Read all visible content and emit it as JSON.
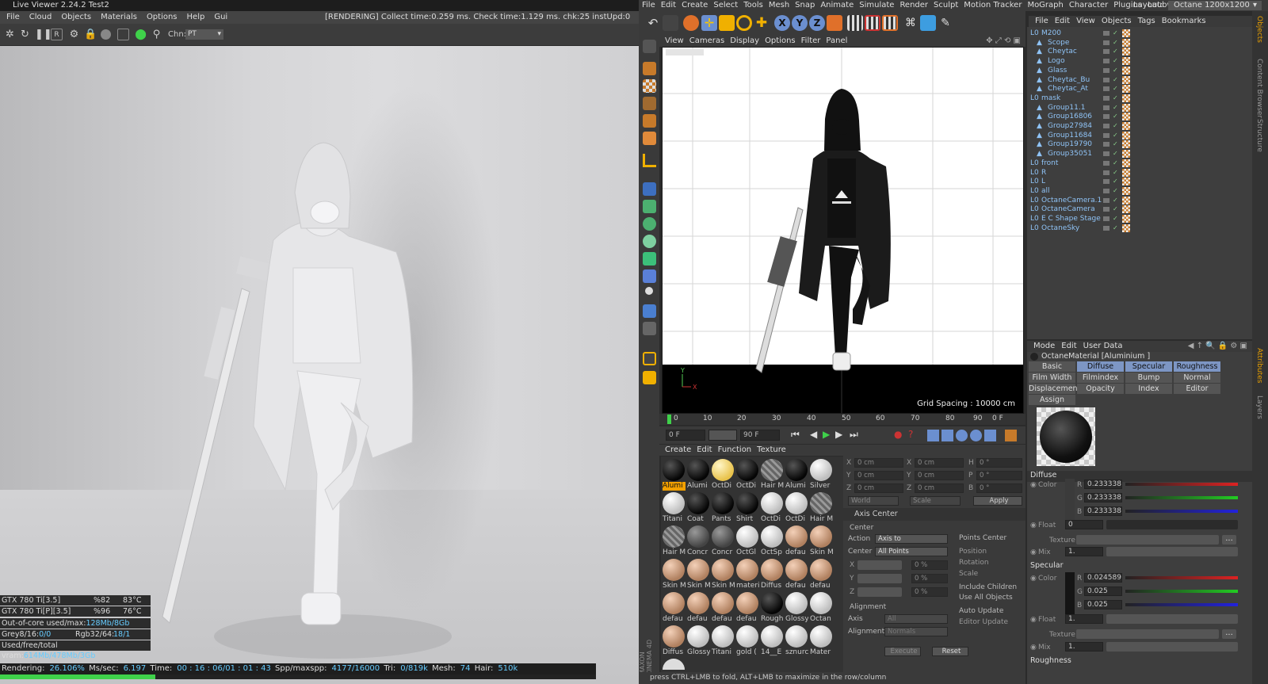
{
  "live_viewer": {
    "title": "Live Viewer 2.24.2 Test2",
    "menu": [
      "File",
      "Cloud",
      "Objects",
      "Materials",
      "Options",
      "Help",
      "Gui"
    ],
    "status": "[RENDERING] Collect time:0.259 ms.  Check time:1.129 ms.  chk:25  instUpd:0",
    "channel_label": "Chn:",
    "channel_value": "PT",
    "gpu_rows": [
      {
        "name": "GTX 780 Ti[3.5]",
        "usage": "%82",
        "temp": "83°C"
      },
      {
        "name": "GTX 780 Ti[P][3.5]",
        "usage": "%96",
        "temp": "76°C"
      }
    ],
    "out_of_core_label": "Out-of-core used/max:",
    "out_of_core_value": "128Mb/8Gb",
    "grey_label": "Grey8/16:",
    "grey_value": "0/0",
    "rgb_label": "Rgb32/64:",
    "rgb_value": "18/1",
    "vram_label": "Used/free/total vram:",
    "vram_value": "614Mb/478Mb/3Gb",
    "stats": {
      "rendering_label": "Rendering:",
      "rendering_value": "26.106%",
      "ms_label": "Ms/sec:",
      "ms_value": "6.197",
      "time_label": "Time:",
      "time_value": "00 : 16 : 06/01 : 01 : 43",
      "spp_label": "Spp/maxspp:",
      "spp_value": "4177/16000",
      "tri_label": "Tri:",
      "tri_value": "0/819k",
      "mesh_label": "Mesh:",
      "mesh_value": "74",
      "hair_label": "Hair:",
      "hair_value": "510k"
    },
    "progress": 0.26106
  },
  "c4d": {
    "menu": [
      "File",
      "Edit",
      "Create",
      "Select",
      "Tools",
      "Mesh",
      "Snap",
      "Animate",
      "Simulate",
      "Render",
      "Sculpt",
      "Motion Tracker",
      "MoGraph",
      "Character",
      "Plugins",
      "Laubw"
    ],
    "layout_label": "Layout:",
    "layout_value": "Octane 1200x1200",
    "viewport_menu": [
      "View",
      "Cameras",
      "Display",
      "Options",
      "Filter",
      "Panel"
    ],
    "grid_spacing": "Grid Spacing : 10000 cm",
    "timeline_ticks": [
      "0",
      "10",
      "20",
      "30",
      "40",
      "50",
      "60",
      "70",
      "80",
      "90"
    ],
    "timeline_end": "0 F",
    "frame_start": "0 F",
    "frame_end": "90 F",
    "material_menu": [
      "Create",
      "Edit",
      "Function",
      "Texture"
    ],
    "materials": [
      "Alumi",
      "Alumi",
      "OctDi",
      "OctDi",
      "Hair M",
      "Alumi",
      "Silver",
      "Titani",
      "Coat",
      "Pants",
      "Shirt",
      "OctDi",
      "OctDi",
      "Hair M",
      "Hair M",
      "Concr",
      "Concr",
      "OctGl",
      "OctSp",
      "defau",
      "Skin M",
      "Skin M",
      "Skin M",
      "Skin M",
      "materi",
      "Diffus",
      "defau",
      "defau",
      "defau",
      "defau",
      "defau",
      "defau",
      "Rough",
      "Glossy",
      "Octan",
      "Diffus",
      "Glossy",
      "Titani",
      "gold (",
      "14__E",
      "sznurc",
      "Mater"
    ],
    "coord": {
      "x_label": "X",
      "y_label": "Y",
      "z_label": "Z",
      "h_label": "H",
      "p_label": "P",
      "b_label": "B",
      "cm": "0 cm",
      "deg": "0 °",
      "world": "World",
      "scale": "Scale",
      "apply": "Apply",
      "axis_center": "Axis Center",
      "center_label": "Center",
      "action_label": "Action",
      "action_value": "Axis to",
      "center2_label": "Center",
      "center2_value": "All Points",
      "percent": "0 %",
      "alignment": "Alignment",
      "axis_label": "Axis",
      "axis_value": "All",
      "alignment2_label": "Alignment",
      "alignment2_value": "Normals",
      "points_center": "Points Center",
      "position": "Position",
      "rotation": "Rotation",
      "scale_opt": "Scale",
      "include_children": "Include Children",
      "use_all_objects": "Use All Objects",
      "auto_update": "Auto Update",
      "editor_update": "Editor Update",
      "execute": "Execute",
      "reset": "Reset"
    },
    "status_bar": "press CTRL+LMB to fold, ALT+LMB to maximize in the row/column",
    "maxon": "MAXON CINEMA 4D"
  },
  "objects": {
    "menu": [
      "File",
      "Edit",
      "View",
      "Objects",
      "Tags",
      "Bookmarks"
    ],
    "rows": [
      {
        "name": "M200",
        "level": 0
      },
      {
        "name": "Scope",
        "level": 1
      },
      {
        "name": "Cheytac",
        "level": 1
      },
      {
        "name": "Logo",
        "level": 1
      },
      {
        "name": "Glass",
        "level": 1
      },
      {
        "name": "Cheytac_Bu",
        "level": 1
      },
      {
        "name": "Cheytac_At",
        "level": 1
      },
      {
        "name": "mask",
        "level": 0
      },
      {
        "name": "Group11.1",
        "level": 1
      },
      {
        "name": "Group16806",
        "level": 1
      },
      {
        "name": "Group27984",
        "level": 1
      },
      {
        "name": "Group11684",
        "level": 1
      },
      {
        "name": "Group19790",
        "level": 1
      },
      {
        "name": "Group35051",
        "level": 1
      },
      {
        "name": "front",
        "level": 0
      },
      {
        "name": "R",
        "level": 0
      },
      {
        "name": "L",
        "level": 0
      },
      {
        "name": "all",
        "level": 0
      },
      {
        "name": "OctaneCamera.1",
        "level": 0
      },
      {
        "name": "OctaneCamera",
        "level": 0
      },
      {
        "name": "E C Shape Stage",
        "level": 0
      },
      {
        "name": "OctaneSky",
        "level": 0
      }
    ],
    "side_tabs": [
      "Objects",
      "Content Browser",
      "Structure"
    ]
  },
  "attributes": {
    "menu": [
      "Mode",
      "Edit",
      "User Data"
    ],
    "title": "OctaneMaterial [Aluminium ]",
    "tabs": [
      [
        "Basic",
        "Diffuse",
        "Specular",
        "Roughness"
      ],
      [
        "Film Width",
        "Filmindex",
        "Bump",
        "Normal"
      ],
      [
        "Displacement",
        "Opacity",
        "Index",
        "Editor"
      ],
      [
        "Assign"
      ]
    ],
    "diffuse_label": "Diffuse",
    "color_label": "Color",
    "r_label": "R",
    "g_label": "G",
    "b_label": "B",
    "diffuse_r": "0.233338",
    "diffuse_g": "0.233338",
    "diffuse_b": "0.233338",
    "float_label": "Float",
    "float_value": "0",
    "texture_label": "Texture",
    "mix_label": "Mix",
    "mix_value": "1.",
    "specular_label": "Specular",
    "spec_r": "0.024589",
    "spec_g": "0.025",
    "spec_b": "0.025",
    "spec_float_value": "1.",
    "spec_mix_value": "1.",
    "roughness_label": "Roughness",
    "side_tabs": [
      "Attributes",
      "Layers"
    ]
  }
}
